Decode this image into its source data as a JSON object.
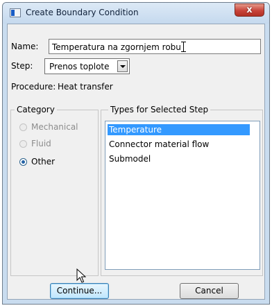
{
  "window": {
    "title": "Create Boundary Condition",
    "close_glyph": "x"
  },
  "name_field": {
    "label": "Name:",
    "value": "Temperatura na zgornjem robu"
  },
  "step_field": {
    "label": "Step:",
    "value": "Prenos toplote"
  },
  "procedure": {
    "label": "Procedure:",
    "value": "Heat transfer"
  },
  "category": {
    "legend": "Category",
    "options": [
      {
        "label": "Mechanical",
        "enabled": false,
        "selected": false
      },
      {
        "label": "Fluid",
        "enabled": false,
        "selected": false
      },
      {
        "label": "Other",
        "enabled": true,
        "selected": true
      }
    ]
  },
  "types": {
    "legend": "Types for Selected Step",
    "items": [
      {
        "label": "Temperature",
        "selected": true
      },
      {
        "label": "Connector material flow",
        "selected": false
      },
      {
        "label": "Submodel",
        "selected": false
      }
    ]
  },
  "buttons": {
    "continue": "Continue...",
    "cancel": "Cancel"
  },
  "icons": {
    "app": "window-icon",
    "close": "close-icon",
    "dropdown": "chevron-down-icon",
    "cursor": "mouse-pointer-icon",
    "text_cursor": "text-cursor-icon"
  }
}
